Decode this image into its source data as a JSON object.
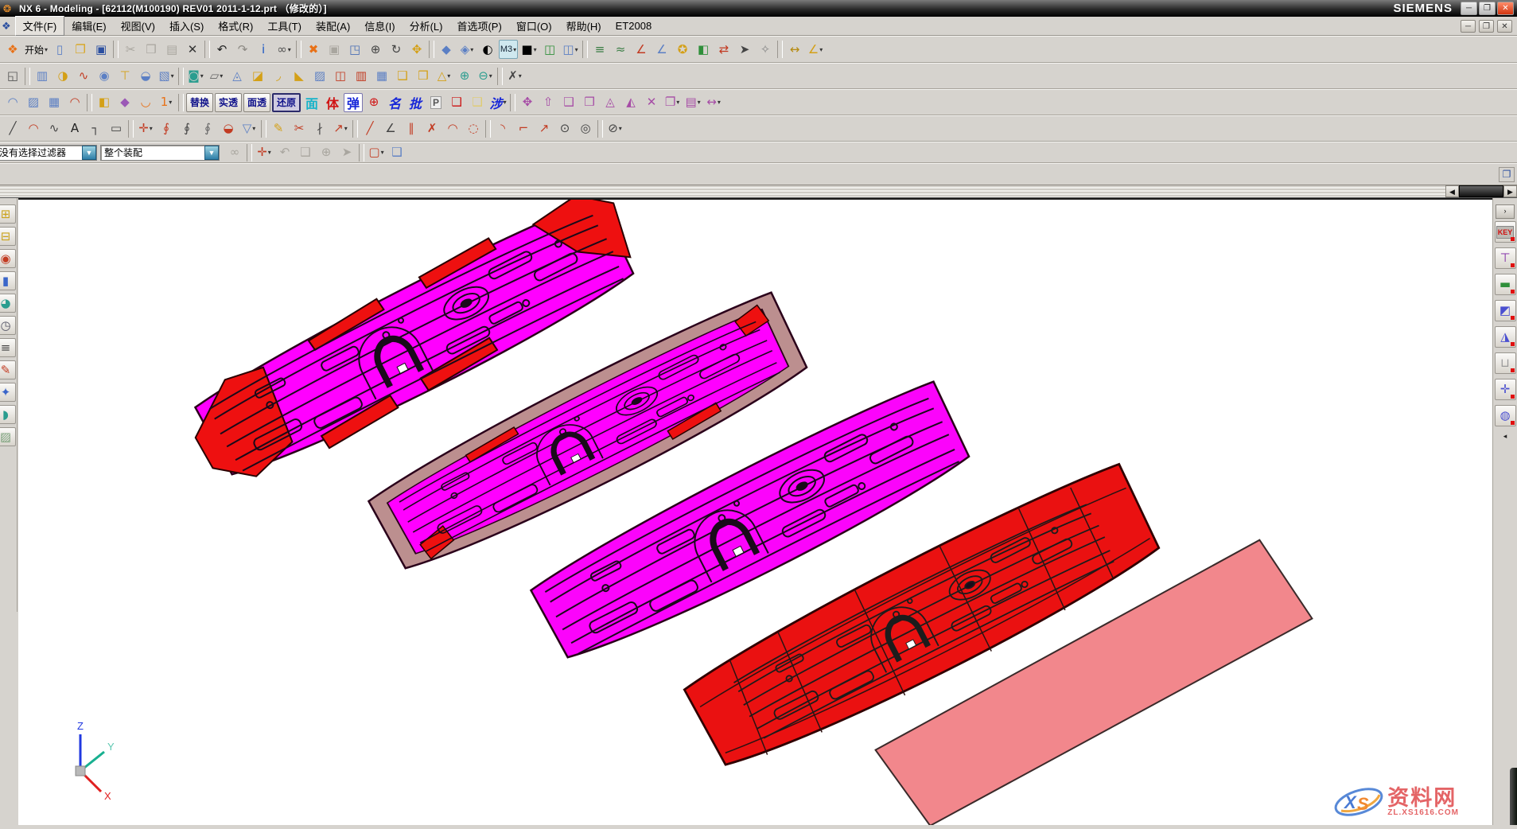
{
  "window": {
    "title": "NX 6 - Modeling - [62112(M100190) REV01 2011-1-12.prt （修改的）]",
    "brand": "SIEMENS",
    "minimize": "─",
    "restore": "❐",
    "close": "✕"
  },
  "menu": {
    "items": [
      {
        "n": "menu-file",
        "label": "文件(F)"
      },
      {
        "n": "menu-edit",
        "label": "编辑(E)"
      },
      {
        "n": "menu-view",
        "label": "视图(V)"
      },
      {
        "n": "menu-insert",
        "label": "插入(S)"
      },
      {
        "n": "menu-format",
        "label": "格式(R)"
      },
      {
        "n": "menu-tools",
        "label": "工具(T)"
      },
      {
        "n": "menu-assemblies",
        "label": "装配(A)"
      },
      {
        "n": "menu-information",
        "label": "信息(I)"
      },
      {
        "n": "menu-analysis",
        "label": "分析(L)"
      },
      {
        "n": "menu-preferences",
        "label": "首选项(P)"
      },
      {
        "n": "menu-window",
        "label": "窗口(O)"
      },
      {
        "n": "menu-help",
        "label": "帮助(H)"
      },
      {
        "n": "menu-et2008",
        "label": "ET2008"
      }
    ]
  },
  "toolbars": {
    "row1": [
      {
        "n": "nx-logo-icon",
        "g": "❖",
        "c": "#e87117"
      },
      {
        "n": "start-button",
        "label": "开始",
        "cls": "startbtn",
        "d": 1
      },
      {
        "n": "new-file-icon",
        "g": "▯",
        "c": "#5b7fc4"
      },
      {
        "n": "open-folder-icon",
        "g": "❐",
        "c": "#d8a520"
      },
      {
        "n": "save-icon",
        "g": "▣",
        "c": "#2b4fa0"
      },
      {
        "sep": 1
      },
      {
        "n": "cut-icon",
        "g": "✂",
        "c": "#a9a69f",
        "dis": 1
      },
      {
        "n": "copy-icon",
        "g": "❒",
        "c": "#a9a69f",
        "dis": 1
      },
      {
        "n": "paste-icon",
        "g": "▤",
        "c": "#a9a69f",
        "dis": 1
      },
      {
        "n": "delete-icon",
        "g": "✕",
        "c": "#333"
      },
      {
        "sep": 1
      },
      {
        "n": "undo-icon",
        "g": "↶",
        "c": "#222"
      },
      {
        "n": "redo-icon",
        "g": "↷",
        "c": "#8d8a84"
      },
      {
        "n": "info-window-icon",
        "g": "i",
        "c": "#1a56c4"
      },
      {
        "n": "find-component-icon",
        "g": "∞",
        "c": "#555",
        "d": 1
      },
      {
        "sep": 1
      },
      {
        "n": "fit-view-icon",
        "g": "✖",
        "c": "#e87117"
      },
      {
        "n": "zoom-disabled-icon",
        "g": "▣",
        "c": "#a9a69f",
        "dis": 1
      },
      {
        "n": "zoom-region-icon",
        "g": "◳",
        "c": "#4a6fb5"
      },
      {
        "n": "zoom-in-out-icon",
        "g": "⊕",
        "c": "#444"
      },
      {
        "n": "rotate-view-icon",
        "g": "↻",
        "c": "#444"
      },
      {
        "n": "pan-view-icon",
        "g": "✥",
        "c": "#d4a017"
      },
      {
        "sep": 1
      },
      {
        "n": "shaded-view-icon",
        "g": "◆",
        "c": "#5b7fc4"
      },
      {
        "n": "orient-view-icon",
        "g": "◈",
        "c": "#5b7fc4",
        "d": 1
      },
      {
        "n": "display-mode-icon",
        "g": "◐",
        "c": "#000"
      },
      {
        "n": "m3-button",
        "label": "M3",
        "cls": "m3",
        "d": 1
      },
      {
        "n": "background-color-icon",
        "g": "■",
        "c": "#000",
        "d": 1
      },
      {
        "n": "clip-section-icon",
        "g": "◫",
        "c": "#2f8f3a"
      },
      {
        "n": "clip-work-section-icon",
        "g": "◫",
        "c": "#5b7fc4",
        "d": 1
      },
      {
        "sep": 1
      },
      {
        "n": "layer-settings-icon",
        "g": "≡",
        "c": "#3a7d44"
      },
      {
        "n": "move-to-layer-icon",
        "g": "≈",
        "c": "#3a7d44"
      },
      {
        "n": "wcs-dynamics-icon",
        "g": "∠",
        "c": "#c23b22"
      },
      {
        "n": "wcs-orient-icon",
        "g": "∠",
        "c": "#5b7fc4"
      },
      {
        "n": "key-function-icon",
        "g": "✪",
        "c": "#d4a017"
      },
      {
        "n": "show-hide-icon",
        "g": "◧",
        "c": "#2f8f3a"
      },
      {
        "n": "swap-visibility-icon",
        "g": "⇄",
        "c": "#c23b22"
      },
      {
        "n": "select-cursor-icon",
        "g": "➤",
        "c": "#444"
      },
      {
        "n": "deselect-all-icon",
        "g": "✧",
        "c": "#888"
      },
      {
        "sep": 1
      },
      {
        "n": "measure-distance-icon",
        "g": "↔",
        "c": "#b58a10"
      },
      {
        "n": "measure-angle-icon",
        "g": "∠",
        "c": "#d4a017",
        "d": 1
      }
    ],
    "row2": [
      {
        "n": "customize-grid-icon",
        "g": "◱",
        "c": "#555"
      },
      {
        "sep": 1
      },
      {
        "n": "extrude-icon",
        "g": "▥",
        "c": "#5b7fc4"
      },
      {
        "n": "revolve-icon",
        "g": "◑",
        "c": "#d4a017"
      },
      {
        "n": "sweep-icon",
        "g": "∿",
        "c": "#c23b22"
      },
      {
        "n": "hole-icon",
        "g": "◉",
        "c": "#5b7fc4"
      },
      {
        "n": "boss-icon",
        "g": "⊤",
        "c": "#d4a017"
      },
      {
        "n": "pad-icon",
        "g": "◒",
        "c": "#5b7fc4"
      },
      {
        "n": "block-icon",
        "g": "▧",
        "c": "#5b7fc4",
        "d": 1
      },
      {
        "sep": 1
      },
      {
        "n": "sketch-icon",
        "g": "◙",
        "c": "#2a9d8f",
        "d": 1
      },
      {
        "n": "datum-plane-icon",
        "g": "▱",
        "c": "#666",
        "d": 1
      },
      {
        "n": "datum-csys-icon",
        "g": "◬",
        "c": "#5b7fc4"
      },
      {
        "n": "shell-icon",
        "g": "◪",
        "c": "#d4a017"
      },
      {
        "n": "edge-blend-icon",
        "g": "◞",
        "c": "#d4a017"
      },
      {
        "n": "chamfer-icon",
        "g": "◣",
        "c": "#d4a017"
      },
      {
        "n": "trimmed-sheet-icon",
        "g": "▨",
        "c": "#5b7fc4"
      },
      {
        "n": "split-body-icon",
        "g": "◫",
        "c": "#c23b22"
      },
      {
        "n": "sew-icon",
        "g": "▥",
        "c": "#c23b22"
      },
      {
        "n": "join-face-icon",
        "g": "▦",
        "c": "#5b7fc4"
      },
      {
        "n": "unite-body-icon",
        "g": "❑",
        "c": "#d4a017"
      },
      {
        "n": "instance-feature-icon",
        "g": "❒",
        "c": "#d4a017"
      },
      {
        "n": "draft-icon",
        "g": "△",
        "c": "#d4a017",
        "d": 1
      },
      {
        "n": "boolean-unite-icon",
        "g": "⊕",
        "c": "#2a9d8f"
      },
      {
        "n": "boolean-subtract-icon",
        "g": "⊖",
        "c": "#2a9d8f",
        "d": 1
      },
      {
        "sep": 1
      },
      {
        "n": "feature-dimension-icon",
        "g": "✗",
        "c": "#444",
        "d": 1
      }
    ],
    "row3": [
      {
        "n": "through-curves-icon",
        "g": "◠",
        "c": "#5b7fc4"
      },
      {
        "n": "ruled-surface-icon",
        "g": "▨",
        "c": "#5b7fc4"
      },
      {
        "n": "curve-mesh-icon",
        "g": "▦",
        "c": "#5b7fc4"
      },
      {
        "n": "swept-surface-icon",
        "g": "◠",
        "c": "#c23b22"
      },
      {
        "sep": 1
      },
      {
        "n": "offset-surface-icon",
        "g": "◧",
        "c": "#d4a017"
      },
      {
        "n": "freeform-icon",
        "g": "◆",
        "c": "#9b59b6"
      },
      {
        "n": "sweep-guide-icon",
        "g": "◡",
        "c": "#e87117"
      },
      {
        "n": "one-step-icon",
        "g": "1",
        "c": "#e87117",
        "d": 1
      },
      {
        "sep": 1
      },
      {
        "n": "replace-button",
        "label": "替换",
        "cls": "txt"
      },
      {
        "n": "solid-translucent-button",
        "label": "实透",
        "cls": "txt"
      },
      {
        "n": "face-translucent-button",
        "label": "面透",
        "cls": "txt"
      },
      {
        "n": "restore-button",
        "label": "还原",
        "cls": "txt pressed"
      },
      {
        "n": "face-tool-button",
        "label": "面",
        "cls": "cjk cyan"
      },
      {
        "n": "body-tool-button",
        "label": "体",
        "cls": "cjk red"
      },
      {
        "n": "spring-tool-button",
        "label": "弹",
        "cls": "cjk blue chipw"
      },
      {
        "n": "center-target-icon",
        "g": "⊕",
        "c": "#d01414"
      },
      {
        "n": "name-tool-button",
        "label": "名",
        "cls": "cjk blue ital"
      },
      {
        "n": "batch-tool-button",
        "label": "批",
        "cls": "cjk blue ital"
      },
      {
        "n": "copy-point-icon",
        "label": "P",
        "cls": "cjk gray"
      },
      {
        "n": "red-solid-icon",
        "g": "❑",
        "c": "#cc1111"
      },
      {
        "n": "yellow-solid-icon",
        "g": "❑",
        "c": "#e0cb6f"
      },
      {
        "n": "interference-button",
        "label": "涉",
        "cls": "cjk blue ital",
        "d": 1
      },
      {
        "sep": 1
      },
      {
        "n": "move-face-icon",
        "g": "✥",
        "c": "#a64ca6"
      },
      {
        "n": "pull-face-icon",
        "g": "⇧",
        "c": "#a64ca6"
      },
      {
        "n": "offset-region-icon",
        "g": "❑",
        "c": "#a64ca6"
      },
      {
        "n": "replace-face-icon",
        "g": "❒",
        "c": "#a64ca6"
      },
      {
        "n": "delete-face-icon",
        "g": "◬",
        "c": "#a64ca6"
      },
      {
        "n": "resize-blend-icon",
        "g": "◭",
        "c": "#a64ca6"
      },
      {
        "n": "remove-feature-icon",
        "g": "✕",
        "c": "#a64ca6"
      },
      {
        "n": "copy-face-icon",
        "g": "❐",
        "c": "#a64ca6",
        "d": 1
      },
      {
        "n": "pattern-face-icon",
        "g": "▤",
        "c": "#a64ca6",
        "d": 1
      },
      {
        "n": "resize-face-icon",
        "g": "↔",
        "c": "#a64ca6",
        "d": 1
      }
    ],
    "row4": [
      {
        "n": "line-icon",
        "g": "╱",
        "c": "#444"
      },
      {
        "n": "arc-icon",
        "g": "◠",
        "c": "#c23b22"
      },
      {
        "n": "spline-icon",
        "g": "∿",
        "c": "#444"
      },
      {
        "n": "text-icon",
        "g": "A",
        "c": "#222"
      },
      {
        "n": "corner-curve-icon",
        "g": "┐",
        "c": "#444"
      },
      {
        "n": "rectangle-icon",
        "g": "▭",
        "c": "#444"
      },
      {
        "sep": 1
      },
      {
        "n": "point-icon",
        "g": "✛",
        "c": "#c23b22",
        "d": 1
      },
      {
        "n": "offset-curve-icon",
        "g": "∮",
        "c": "#c23b22"
      },
      {
        "n": "offset-in-face-icon",
        "g": "∮",
        "c": "#444"
      },
      {
        "n": "bridge-curve-icon",
        "g": "∮",
        "c": "#666"
      },
      {
        "n": "project-curve-icon",
        "g": "◒",
        "c": "#c23b22"
      },
      {
        "n": "intersect-curve-icon",
        "g": "▽",
        "c": "#5b7fc4",
        "d": 1
      },
      {
        "sep": 1
      },
      {
        "n": "edit-parameters-icon",
        "g": "✎",
        "c": "#d4a017"
      },
      {
        "n": "trim-curve-icon",
        "g": "✂",
        "c": "#c23b22"
      },
      {
        "n": "divide-curve-icon",
        "g": "∤",
        "c": "#444"
      },
      {
        "n": "curve-length-icon",
        "g": "↗",
        "c": "#c23b22",
        "d": 1
      },
      {
        "sep": 1
      },
      {
        "n": "basic-line-icon",
        "g": "╱",
        "c": "#c23b22"
      },
      {
        "n": "line-point-angle-icon",
        "g": "∠",
        "c": "#444"
      },
      {
        "n": "parallel-line-icon",
        "g": "∥",
        "c": "#c23b22"
      },
      {
        "n": "perpendicular-line-icon",
        "g": "✗",
        "c": "#c23b22"
      },
      {
        "n": "basic-arc-icon",
        "g": "◠",
        "c": "#c23b22"
      },
      {
        "n": "dotted-circle-icon",
        "g": "◌",
        "c": "#c23b22"
      },
      {
        "sep": 1
      },
      {
        "n": "fillet-corner-icon",
        "g": "◝",
        "c": "#c23b22"
      },
      {
        "n": "chamfer-corner-icon",
        "g": "⌐",
        "c": "#c23b22"
      },
      {
        "n": "trim-corner-icon",
        "g": "↗",
        "c": "#c23b22"
      },
      {
        "n": "circle-center-icon",
        "g": "⊙",
        "c": "#444"
      },
      {
        "n": "circle-tangent-icon",
        "g": "◎",
        "c": "#444"
      },
      {
        "sep": 1
      },
      {
        "n": "circle-diameter-icon",
        "g": "⊘",
        "c": "#444",
        "d": 1
      }
    ]
  },
  "selection_bar": {
    "filter_value": "没有选择过滤器",
    "scope_value": "整个装配",
    "icons": [
      {
        "n": "interpart-link-icon",
        "g": "∞",
        "c": "#a9a69f",
        "dis": 1
      },
      {
        "sep": 1
      },
      {
        "n": "snap-point-icon",
        "g": "✛",
        "c": "#c23b22",
        "d": 1
      },
      {
        "n": "undo-selection-icon",
        "g": "↶",
        "c": "#a9a69f",
        "dis": 1
      },
      {
        "n": "solid-preview-icon",
        "g": "❑",
        "c": "#8d8a84",
        "dis": 1
      },
      {
        "n": "add-snap-icon",
        "g": "⊕",
        "c": "#a9a69f",
        "dis": 1
      },
      {
        "n": "arrow-snap-icon",
        "g": "➤",
        "c": "#a9a69f",
        "dis": 1
      },
      {
        "sep": 1
      },
      {
        "n": "rectangle-select-icon",
        "g": "▢",
        "c": "#c23b22",
        "d": 1
      },
      {
        "n": "shaded-solid-icon",
        "g": "❑",
        "c": "#5b7fc4"
      }
    ]
  },
  "left_toolbar": {
    "icons": [
      {
        "n": "schematic-icon",
        "g": "⊞",
        "c": "#caa21a"
      },
      {
        "n": "filter-node-icon",
        "g": "⊟",
        "c": "#caa21a"
      },
      {
        "n": "track-point-icon",
        "g": "◉",
        "c": "#c23b22"
      },
      {
        "n": "blue-tool-icon",
        "g": "▮",
        "c": "#3b66c9"
      },
      {
        "n": "globe-icon",
        "g": "◕",
        "c": "#2a9d8f"
      },
      {
        "n": "history-clock-icon",
        "g": "◷",
        "c": "#556"
      },
      {
        "n": "detail-list-icon",
        "g": "≡",
        "c": "#444"
      },
      {
        "n": "appearance-pencil-icon",
        "g": "✎",
        "c": "#c23b22"
      },
      {
        "n": "analysis-tool-icon",
        "g": "✦",
        "c": "#3b66c9"
      },
      {
        "n": "roles-people-icon",
        "g": "◗",
        "c": "#2a9d8f"
      },
      {
        "n": "scene-image-icon",
        "g": "▨",
        "c": "#7aa07a"
      }
    ]
  },
  "resource_bar": {
    "expand_label": "›",
    "icons": [
      {
        "n": "key-library-icon",
        "label": "KEY",
        "cls": "keychip"
      },
      {
        "n": "part-tslot-icon",
        "g": "⊤",
        "c": "#7a1fa2"
      },
      {
        "n": "part-green-block-icon",
        "g": "▬",
        "c": "#2f8f3a"
      },
      {
        "n": "part-plate-icon",
        "g": "◩",
        "c": "#4a4fd0"
      },
      {
        "n": "part-bracket-icon",
        "g": "◮",
        "c": "#4a4fd0"
      },
      {
        "n": "part-funnel-icon",
        "g": "⊔",
        "c": "#9a9a9a"
      },
      {
        "n": "part-cross-icon",
        "g": "✛",
        "c": "#4a4fd0"
      },
      {
        "n": "part-knob-icon",
        "g": "◍",
        "c": "#4a4fd0"
      }
    ],
    "collapse_label": "◂"
  },
  "viewport": {
    "triad": {
      "x_label": "X",
      "y_label": "Y",
      "z_label": "Z",
      "x_color": "#e02020",
      "y_color": "#18b090",
      "z_color": "#2038e0"
    },
    "watermark": {
      "logo_text": "XS",
      "site_name": "资料网",
      "site_url": "ZL.XS1616.COM"
    },
    "parts": [
      {
        "name": "die-face-1",
        "fill": "#ff00ff",
        "flange": "#ee1010"
      },
      {
        "name": "die-face-2",
        "fill": "#ff00ff",
        "flange": "#bc8f8f"
      },
      {
        "name": "die-face-3",
        "fill": "#fb04fb",
        "flange": "#fb04fb"
      },
      {
        "name": "die-face-4",
        "fill": "#ea1111",
        "flange": "#ea1111"
      },
      {
        "name": "blank-sheet",
        "fill": "#f2878c",
        "flange": "#f2878c"
      }
    ]
  }
}
